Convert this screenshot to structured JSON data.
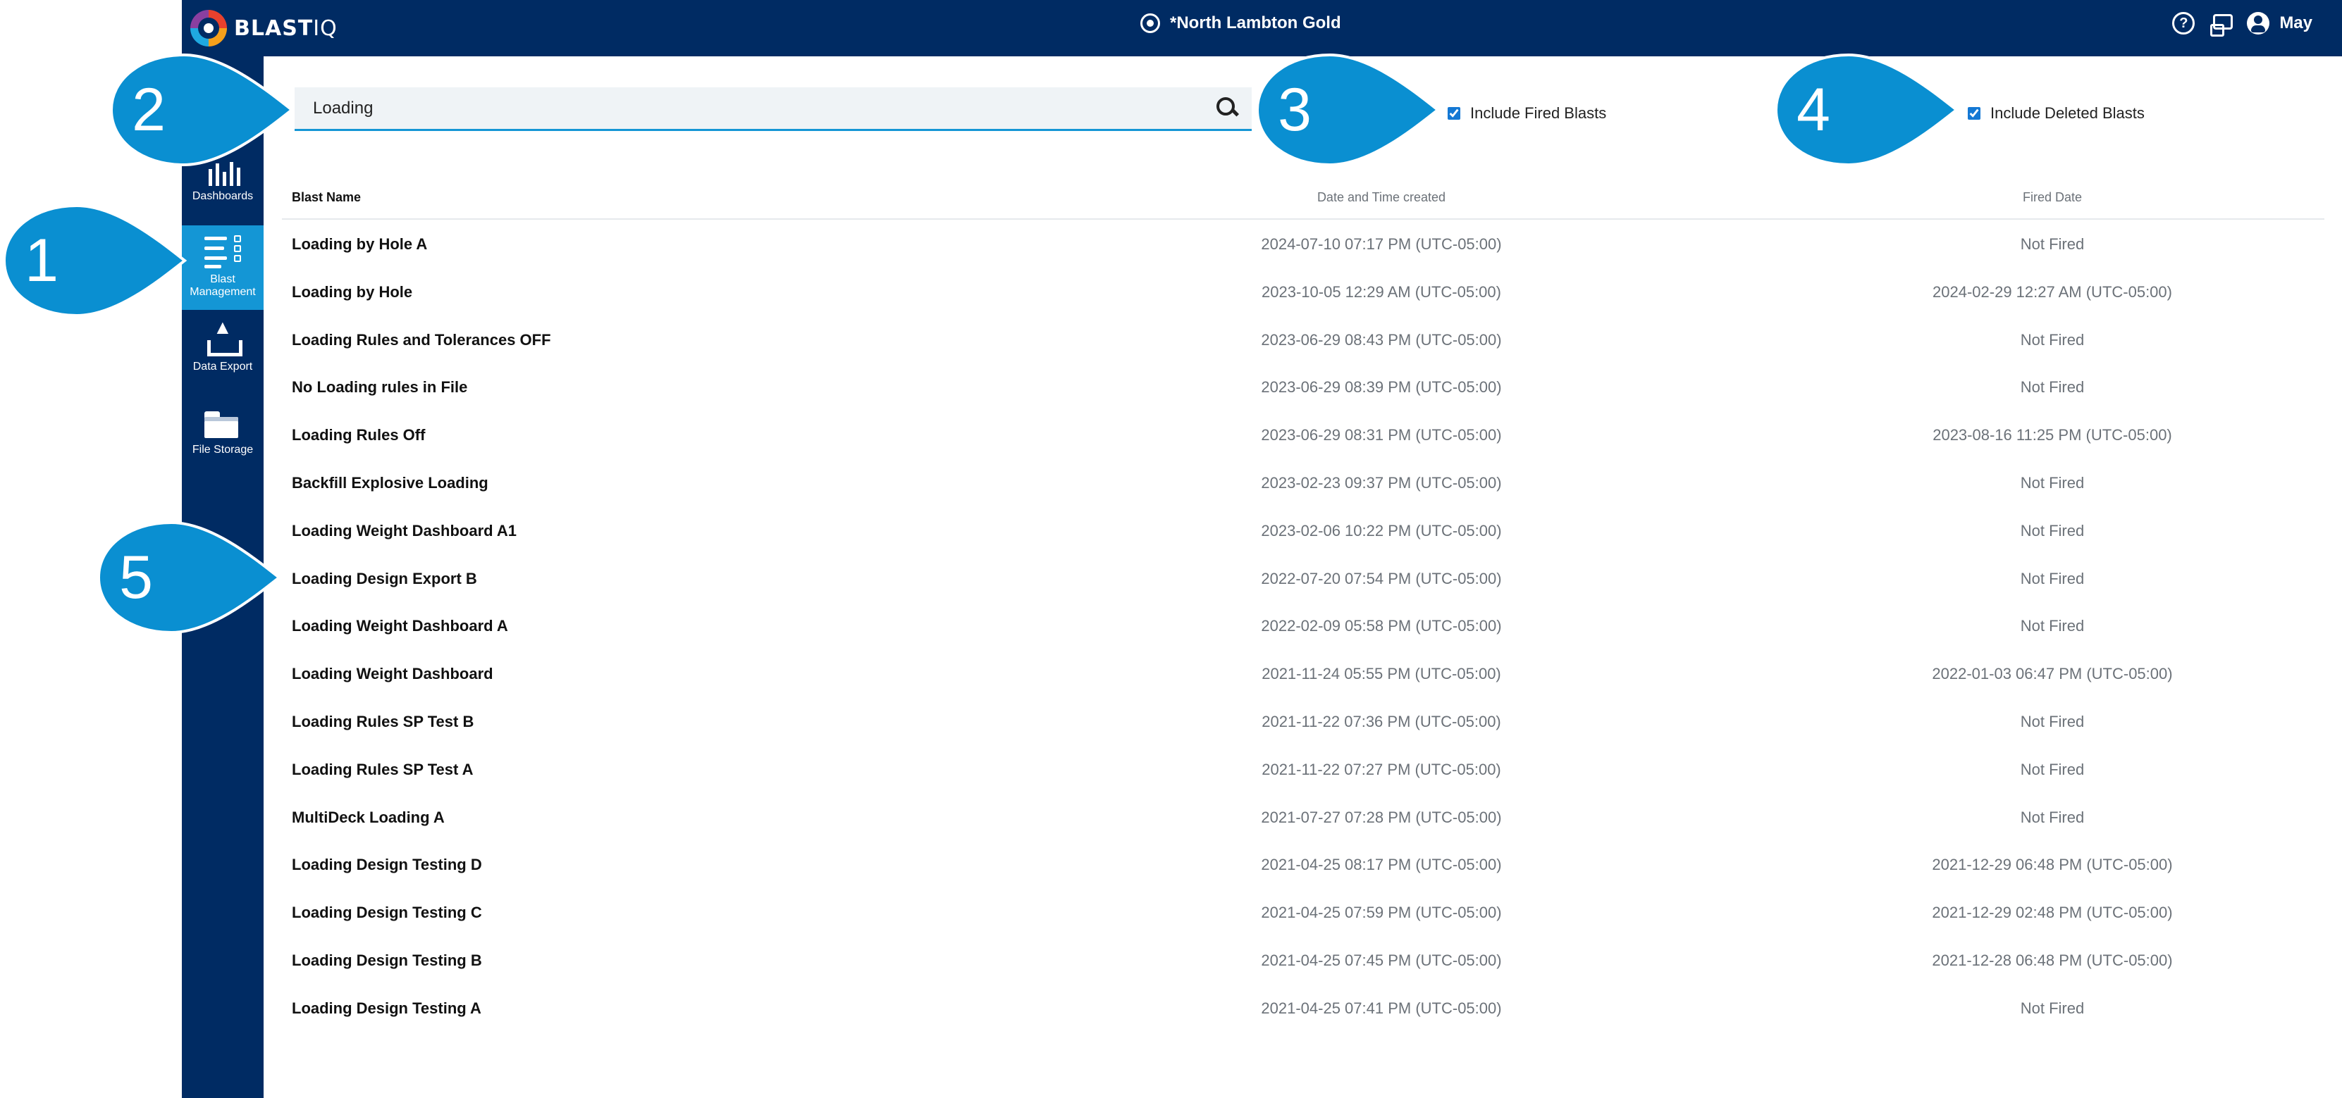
{
  "app": {
    "logo_text": "BLAST",
    "logo_suffix": "IQ"
  },
  "header": {
    "site_name": "*North Lambton Gold",
    "help_glyph": "?",
    "user_name": "May"
  },
  "sidebar": {
    "items": [
      {
        "label": "Dashboards",
        "icon": "dashboard-icon"
      },
      {
        "label": "Blast Management",
        "icon": "list-icon",
        "active": true
      },
      {
        "label": "Data Export",
        "icon": "upload-icon"
      },
      {
        "label": "File Storage",
        "icon": "folder-icon"
      }
    ]
  },
  "search": {
    "value": "Loading"
  },
  "filters": {
    "include_fired_label": "Include Fired Blasts",
    "include_fired_checked": true,
    "include_deleted_label": "Include Deleted Blasts",
    "include_deleted_checked": true
  },
  "table": {
    "headers": [
      "Blast Name",
      "Date and Time created",
      "Fired Date"
    ],
    "rows": [
      [
        "Loading by Hole A",
        "2024-07-10 07:17 PM (UTC-05:00)",
        "Not Fired"
      ],
      [
        "Loading by Hole",
        "2023-10-05 12:29 AM (UTC-05:00)",
        "2024-02-29 12:27 AM (UTC-05:00)"
      ],
      [
        "Loading Rules and Tolerances OFF",
        "2023-06-29 08:43 PM (UTC-05:00)",
        "Not Fired"
      ],
      [
        "No Loading rules in File",
        "2023-06-29 08:39 PM (UTC-05:00)",
        "Not Fired"
      ],
      [
        "Loading Rules Off",
        "2023-06-29 08:31 PM (UTC-05:00)",
        "2023-08-16 11:25 PM (UTC-05:00)"
      ],
      [
        "Backfill Explosive Loading",
        "2023-02-23 09:37 PM (UTC-05:00)",
        "Not Fired"
      ],
      [
        "Loading Weight Dashboard A1",
        "2023-02-06 10:22 PM (UTC-05:00)",
        "Not Fired"
      ],
      [
        "Loading Design Export B",
        "2022-07-20 07:54 PM (UTC-05:00)",
        "Not Fired"
      ],
      [
        "Loading Weight Dashboard A",
        "2022-02-09 05:58 PM (UTC-05:00)",
        "Not Fired"
      ],
      [
        "Loading Weight Dashboard",
        "2021-11-24 05:55 PM (UTC-05:00)",
        "2022-01-03 06:47 PM (UTC-05:00)"
      ],
      [
        "Loading Rules SP Test B",
        "2021-11-22 07:36 PM (UTC-05:00)",
        "Not Fired"
      ],
      [
        "Loading Rules SP Test A",
        "2021-11-22 07:27 PM (UTC-05:00)",
        "Not Fired"
      ],
      [
        "MultiDeck Loading A",
        "2021-07-27 07:28 PM (UTC-05:00)",
        "Not Fired"
      ],
      [
        "Loading Design Testing D",
        "2021-04-25 08:17 PM (UTC-05:00)",
        "2021-12-29 06:48 PM (UTC-05:00)"
      ],
      [
        "Loading Design Testing C",
        "2021-04-25 07:59 PM (UTC-05:00)",
        "2021-12-29 02:48 PM (UTC-05:00)"
      ],
      [
        "Loading Design Testing B",
        "2021-04-25 07:45 PM (UTC-05:00)",
        "2021-12-28 06:48 PM (UTC-05:00)"
      ],
      [
        "Loading Design Testing A",
        "2021-04-25 07:41 PM (UTC-05:00)",
        "Not Fired"
      ]
    ]
  },
  "callouts": [
    "1",
    "2",
    "3",
    "4",
    "5"
  ],
  "colors": {
    "header_bg": "#002b63",
    "active_nav": "#1496d5",
    "callout": "#0a8fd1"
  }
}
